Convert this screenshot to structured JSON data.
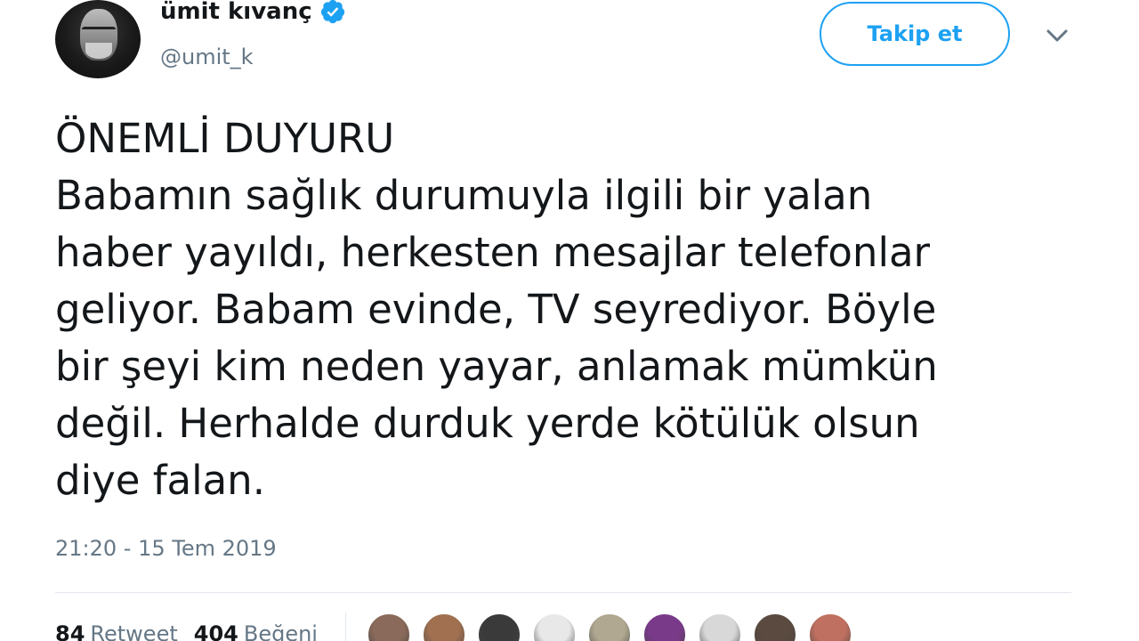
{
  "user": {
    "display_name": "ümit kıvanç",
    "handle": "@umit_k",
    "verified_icon": "verified-badge-icon"
  },
  "actions": {
    "follow_label": "Takip et",
    "more_icon": "chevron-down-icon"
  },
  "tweet": {
    "text": "ÖNEMLİ DUYURU\nBabamın sağlık durumuyla ilgili bir yalan\nhaber yayıldı, herkesten mesajlar telefonlar\ngeliyor. Babam evinde, TV seyrediyor. Böyle\nbir şeyi kim neden yayar, anlamak mümkün\ndeğil. Herhalde durduk yerde kötülük olsun\ndiye falan.",
    "timestamp": "21:20 - 15 Tem 2019"
  },
  "stats": {
    "retweet_count": "84",
    "retweet_label": "Retweet",
    "like_count": "404",
    "like_label": "Beğeni"
  },
  "colors": {
    "accent": "#1da1f2",
    "text": "#14171a",
    "secondary": "#657786",
    "divider": "#e1e8ed"
  },
  "likers": [
    {
      "color": "#8a6a5a"
    },
    {
      "color": "#a07050"
    },
    {
      "color": "#3a3a3a"
    },
    {
      "color": "#e8e8e8"
    },
    {
      "color": "#b0a890"
    },
    {
      "color": "#7a3a8a"
    },
    {
      "color": "#d8d8d8"
    },
    {
      "color": "#5a4a40"
    },
    {
      "color": "#c07060"
    }
  ]
}
